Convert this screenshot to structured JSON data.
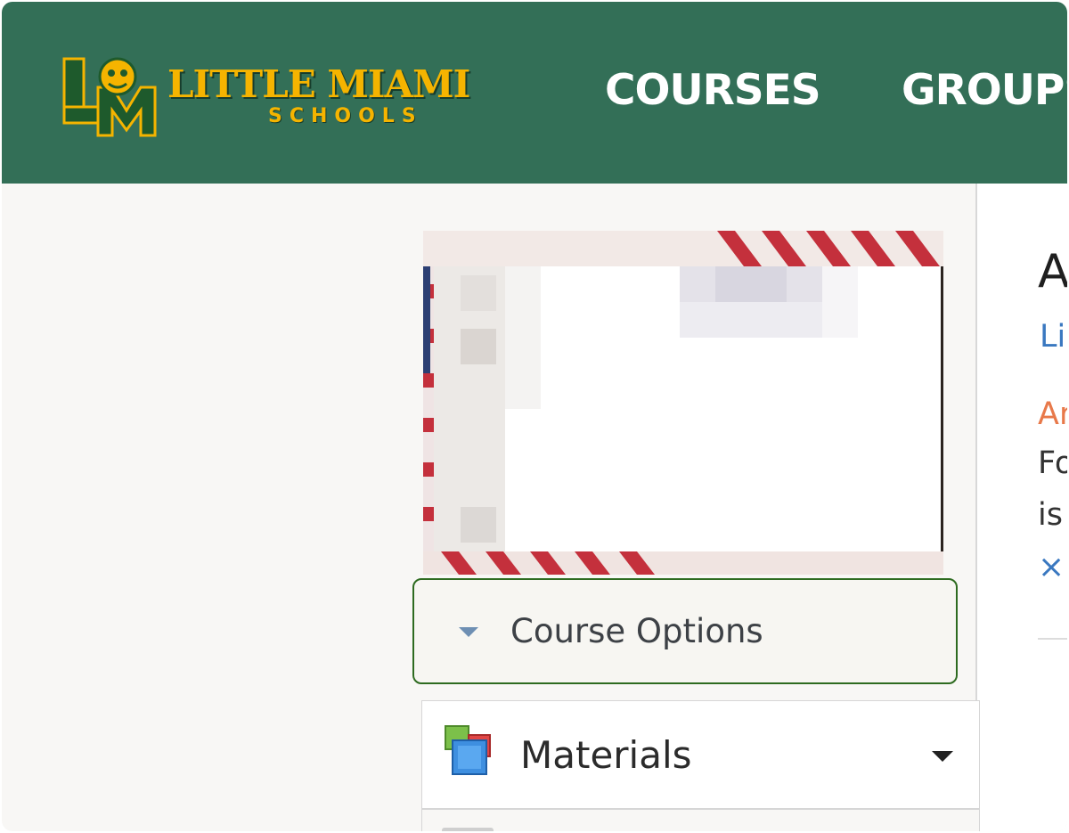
{
  "header": {
    "logo": {
      "line1": "LITTLE MIAMI",
      "line2": "SCHOOLS",
      "monogram": "LM"
    },
    "nav": [
      {
        "label": "COURSES"
      },
      {
        "label": "GROUPS"
      }
    ],
    "colors": {
      "background": "#336f57",
      "logo": "#f5b400",
      "nav_text": "#ffffff"
    }
  },
  "sidebar": {
    "course_options": {
      "label": "Course Options",
      "icon": "caret-down-icon"
    },
    "materials": {
      "label": "Materials",
      "icon": "materials-icon",
      "chevron": "chevron-down-icon"
    },
    "accent_outline": "#2e6b20"
  },
  "main": {
    "heading": "A",
    "link": "Li",
    "alert": "Ar",
    "text_line1": "Fo",
    "text_line2": "is",
    "close": "×",
    "link_color": "#3a78c0",
    "alert_color": "#e8794a"
  }
}
